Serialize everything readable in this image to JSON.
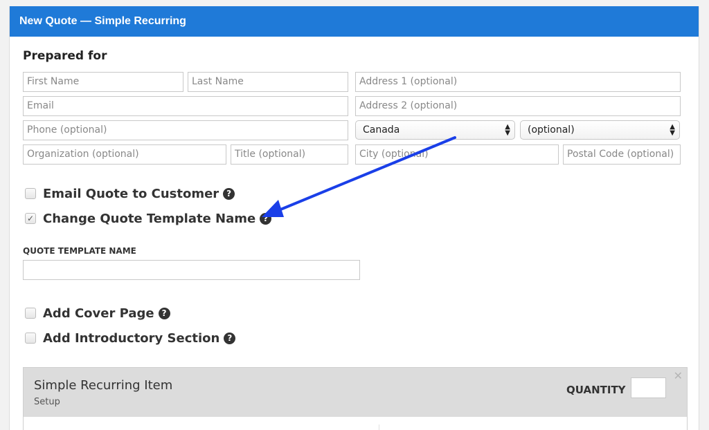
{
  "header": {
    "title": "New Quote — Simple Recurring"
  },
  "prepared_for": {
    "title": "Prepared for",
    "first_name": "First Name",
    "last_name": "Last Name",
    "email": "Email",
    "phone": "Phone (optional)",
    "organization": "Organization (optional)",
    "job_title": "Title (optional)",
    "address1": "Address 1 (optional)",
    "address2": "Address 2 (optional)",
    "country": "Canada",
    "region": "(optional)",
    "city": "City (optional)",
    "postal_code": "Postal Code (optional)"
  },
  "options": {
    "email_quote": {
      "label": "Email Quote to Customer",
      "checked": false
    },
    "change_template_name": {
      "label": "Change Quote Template Name",
      "checked": true
    },
    "template_name_label": "QUOTE TEMPLATE NAME",
    "template_name_value": "",
    "add_cover_page": {
      "label": "Add Cover Page",
      "checked": false
    },
    "add_intro_section": {
      "label": "Add Introductory Section",
      "checked": false
    }
  },
  "item": {
    "name": "Simple Recurring Item",
    "subtitle": "Setup",
    "quantity_label": "QUANTITY",
    "quantity_value": ""
  },
  "annotation": {
    "arrow_color": "#1a3fe8"
  },
  "icons": {
    "help": "question-circle-icon",
    "close": "close-icon",
    "check": "checkmark-icon"
  },
  "colors": {
    "header": "#1f7ad8"
  }
}
